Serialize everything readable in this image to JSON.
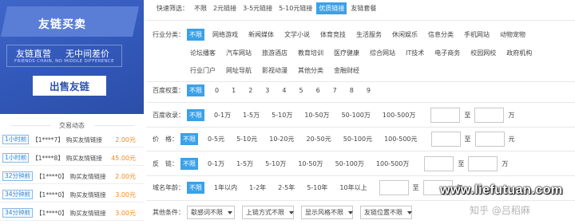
{
  "banner": {
    "title": "友链买卖",
    "slogan_a": "友链直营",
    "slogan_b": "无中间差价",
    "slogan_en": "FRIENDS CHAIN, NO MIDDLE DIFFERENCE",
    "sell_button": "出售友链"
  },
  "transactions": {
    "title": "交易动态",
    "rows": [
      {
        "time": "1小时前",
        "user": "【1****7】",
        "action": "购买友情链接",
        "price": "2.00元"
      },
      {
        "time": "1小时前",
        "user": "【1****8】",
        "action": "购买友情链接",
        "price": "45.00元"
      },
      {
        "time": "32分钟前",
        "user": "【1****0】",
        "action": "购买友情链接",
        "price": "2.00元"
      },
      {
        "time": "34分钟前",
        "user": "【1****0】",
        "action": "购买友情链接",
        "price": "3.00元"
      },
      {
        "time": "34分钟前",
        "user": "【1****0】",
        "action": "购买友情链接",
        "price": "3.00元"
      }
    ]
  },
  "filters": {
    "quick": {
      "label": "快速筛选：",
      "options": [
        "不限",
        "2元链接",
        "3-5元链接",
        "5-10元链接",
        "优质链接",
        "友链套餐"
      ],
      "active_index": 4
    },
    "industry": {
      "label": "行业分类：",
      "row1": [
        "不限",
        "网络游戏",
        "新闻媒体",
        "文学小说",
        "体育竞技",
        "生活服务",
        "休闲娱乐",
        "信息分类",
        "手机网站",
        "动物宠物"
      ],
      "row2": [
        "论坛播客",
        "汽车网站",
        "旅游酒店",
        "教育培训",
        "医疗健康",
        "综合网站",
        "IT技术",
        "电子商务",
        "校园网校",
        "政府机构"
      ],
      "row3": [
        "行业门户",
        "网址导航",
        "影视动漫",
        "其他分类",
        "金融财经"
      ]
    },
    "baidu_weight": {
      "label": "百度权重：",
      "options": [
        "不限",
        "0",
        "1",
        "2",
        "3",
        "4",
        "5",
        "6",
        "7",
        "8",
        "9"
      ]
    },
    "baidu_index": {
      "label": "百度收录：",
      "options": [
        "不限",
        "0-1万",
        "1-5万",
        "5-10万",
        "10-50万",
        "50-100万",
        "100-500万"
      ],
      "to": "至",
      "unit": "万"
    },
    "price": {
      "label": "价　格：",
      "options": [
        "不限",
        "0-5元",
        "5-10元",
        "10-20元",
        "20-50元",
        "50-100元",
        "100-500元"
      ],
      "to": "至",
      "unit": "元"
    },
    "backlinks": {
      "label": "反　链：",
      "options": [
        "不限",
        "0-1万",
        "1-5万",
        "5-10万",
        "10-50万",
        "50-100万",
        "100-500万"
      ],
      "to": "至",
      "unit": "万"
    },
    "domain_age": {
      "label": "域名年龄：",
      "options": [
        "不限",
        "1年以内",
        "1-2年",
        "2-5年",
        "5-10年",
        "10年以上"
      ],
      "to": "至",
      "unit": "年"
    },
    "other": {
      "label": "其他条件：",
      "selects": [
        "歇感词不限",
        "上链方式不限",
        "显示风格不限",
        "友链位置不限"
      ]
    }
  },
  "watermark": {
    "site": "www.liefutuan.com",
    "author": "知乎 @吕稻麻"
  },
  "colors": {
    "accent": "#3ba1e8",
    "banner": "#3157b8",
    "price": "#f08a1c"
  }
}
